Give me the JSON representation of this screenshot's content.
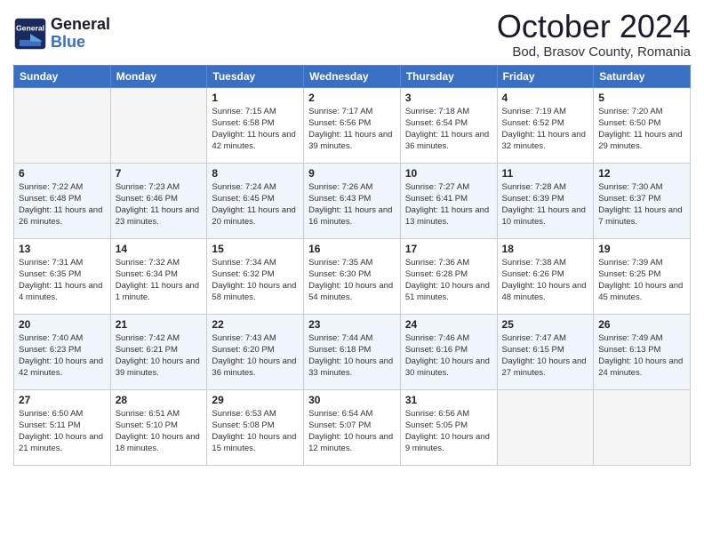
{
  "header": {
    "logo_text_general": "General",
    "logo_text_blue": "Blue",
    "title": "October 2024",
    "location": "Bod, Brasov County, Romania"
  },
  "weekdays": [
    "Sunday",
    "Monday",
    "Tuesday",
    "Wednesday",
    "Thursday",
    "Friday",
    "Saturday"
  ],
  "weeks": [
    [
      {
        "day": "",
        "sunrise": "",
        "sunset": "",
        "daylight": "",
        "empty": true
      },
      {
        "day": "",
        "sunrise": "",
        "sunset": "",
        "daylight": "",
        "empty": true
      },
      {
        "day": "1",
        "sunrise": "Sunrise: 7:15 AM",
        "sunset": "Sunset: 6:58 PM",
        "daylight": "Daylight: 11 hours and 42 minutes."
      },
      {
        "day": "2",
        "sunrise": "Sunrise: 7:17 AM",
        "sunset": "Sunset: 6:56 PM",
        "daylight": "Daylight: 11 hours and 39 minutes."
      },
      {
        "day": "3",
        "sunrise": "Sunrise: 7:18 AM",
        "sunset": "Sunset: 6:54 PM",
        "daylight": "Daylight: 11 hours and 36 minutes."
      },
      {
        "day": "4",
        "sunrise": "Sunrise: 7:19 AM",
        "sunset": "Sunset: 6:52 PM",
        "daylight": "Daylight: 11 hours and 32 minutes."
      },
      {
        "day": "5",
        "sunrise": "Sunrise: 7:20 AM",
        "sunset": "Sunset: 6:50 PM",
        "daylight": "Daylight: 11 hours and 29 minutes."
      }
    ],
    [
      {
        "day": "6",
        "sunrise": "Sunrise: 7:22 AM",
        "sunset": "Sunset: 6:48 PM",
        "daylight": "Daylight: 11 hours and 26 minutes."
      },
      {
        "day": "7",
        "sunrise": "Sunrise: 7:23 AM",
        "sunset": "Sunset: 6:46 PM",
        "daylight": "Daylight: 11 hours and 23 minutes."
      },
      {
        "day": "8",
        "sunrise": "Sunrise: 7:24 AM",
        "sunset": "Sunset: 6:45 PM",
        "daylight": "Daylight: 11 hours and 20 minutes."
      },
      {
        "day": "9",
        "sunrise": "Sunrise: 7:26 AM",
        "sunset": "Sunset: 6:43 PM",
        "daylight": "Daylight: 11 hours and 16 minutes."
      },
      {
        "day": "10",
        "sunrise": "Sunrise: 7:27 AM",
        "sunset": "Sunset: 6:41 PM",
        "daylight": "Daylight: 11 hours and 13 minutes."
      },
      {
        "day": "11",
        "sunrise": "Sunrise: 7:28 AM",
        "sunset": "Sunset: 6:39 PM",
        "daylight": "Daylight: 11 hours and 10 minutes."
      },
      {
        "day": "12",
        "sunrise": "Sunrise: 7:30 AM",
        "sunset": "Sunset: 6:37 PM",
        "daylight": "Daylight: 11 hours and 7 minutes."
      }
    ],
    [
      {
        "day": "13",
        "sunrise": "Sunrise: 7:31 AM",
        "sunset": "Sunset: 6:35 PM",
        "daylight": "Daylight: 11 hours and 4 minutes."
      },
      {
        "day": "14",
        "sunrise": "Sunrise: 7:32 AM",
        "sunset": "Sunset: 6:34 PM",
        "daylight": "Daylight: 11 hours and 1 minute."
      },
      {
        "day": "15",
        "sunrise": "Sunrise: 7:34 AM",
        "sunset": "Sunset: 6:32 PM",
        "daylight": "Daylight: 10 hours and 58 minutes."
      },
      {
        "day": "16",
        "sunrise": "Sunrise: 7:35 AM",
        "sunset": "Sunset: 6:30 PM",
        "daylight": "Daylight: 10 hours and 54 minutes."
      },
      {
        "day": "17",
        "sunrise": "Sunrise: 7:36 AM",
        "sunset": "Sunset: 6:28 PM",
        "daylight": "Daylight: 10 hours and 51 minutes."
      },
      {
        "day": "18",
        "sunrise": "Sunrise: 7:38 AM",
        "sunset": "Sunset: 6:26 PM",
        "daylight": "Daylight: 10 hours and 48 minutes."
      },
      {
        "day": "19",
        "sunrise": "Sunrise: 7:39 AM",
        "sunset": "Sunset: 6:25 PM",
        "daylight": "Daylight: 10 hours and 45 minutes."
      }
    ],
    [
      {
        "day": "20",
        "sunrise": "Sunrise: 7:40 AM",
        "sunset": "Sunset: 6:23 PM",
        "daylight": "Daylight: 10 hours and 42 minutes."
      },
      {
        "day": "21",
        "sunrise": "Sunrise: 7:42 AM",
        "sunset": "Sunset: 6:21 PM",
        "daylight": "Daylight: 10 hours and 39 minutes."
      },
      {
        "day": "22",
        "sunrise": "Sunrise: 7:43 AM",
        "sunset": "Sunset: 6:20 PM",
        "daylight": "Daylight: 10 hours and 36 minutes."
      },
      {
        "day": "23",
        "sunrise": "Sunrise: 7:44 AM",
        "sunset": "Sunset: 6:18 PM",
        "daylight": "Daylight: 10 hours and 33 minutes."
      },
      {
        "day": "24",
        "sunrise": "Sunrise: 7:46 AM",
        "sunset": "Sunset: 6:16 PM",
        "daylight": "Daylight: 10 hours and 30 minutes."
      },
      {
        "day": "25",
        "sunrise": "Sunrise: 7:47 AM",
        "sunset": "Sunset: 6:15 PM",
        "daylight": "Daylight: 10 hours and 27 minutes."
      },
      {
        "day": "26",
        "sunrise": "Sunrise: 7:49 AM",
        "sunset": "Sunset: 6:13 PM",
        "daylight": "Daylight: 10 hours and 24 minutes."
      }
    ],
    [
      {
        "day": "27",
        "sunrise": "Sunrise: 6:50 AM",
        "sunset": "Sunset: 5:11 PM",
        "daylight": "Daylight: 10 hours and 21 minutes."
      },
      {
        "day": "28",
        "sunrise": "Sunrise: 6:51 AM",
        "sunset": "Sunset: 5:10 PM",
        "daylight": "Daylight: 10 hours and 18 minutes."
      },
      {
        "day": "29",
        "sunrise": "Sunrise: 6:53 AM",
        "sunset": "Sunset: 5:08 PM",
        "daylight": "Daylight: 10 hours and 15 minutes."
      },
      {
        "day": "30",
        "sunrise": "Sunrise: 6:54 AM",
        "sunset": "Sunset: 5:07 PM",
        "daylight": "Daylight: 10 hours and 12 minutes."
      },
      {
        "day": "31",
        "sunrise": "Sunrise: 6:56 AM",
        "sunset": "Sunset: 5:05 PM",
        "daylight": "Daylight: 10 hours and 9 minutes."
      },
      {
        "day": "",
        "sunrise": "",
        "sunset": "",
        "daylight": "",
        "empty": true
      },
      {
        "day": "",
        "sunrise": "",
        "sunset": "",
        "daylight": "",
        "empty": true
      }
    ]
  ]
}
